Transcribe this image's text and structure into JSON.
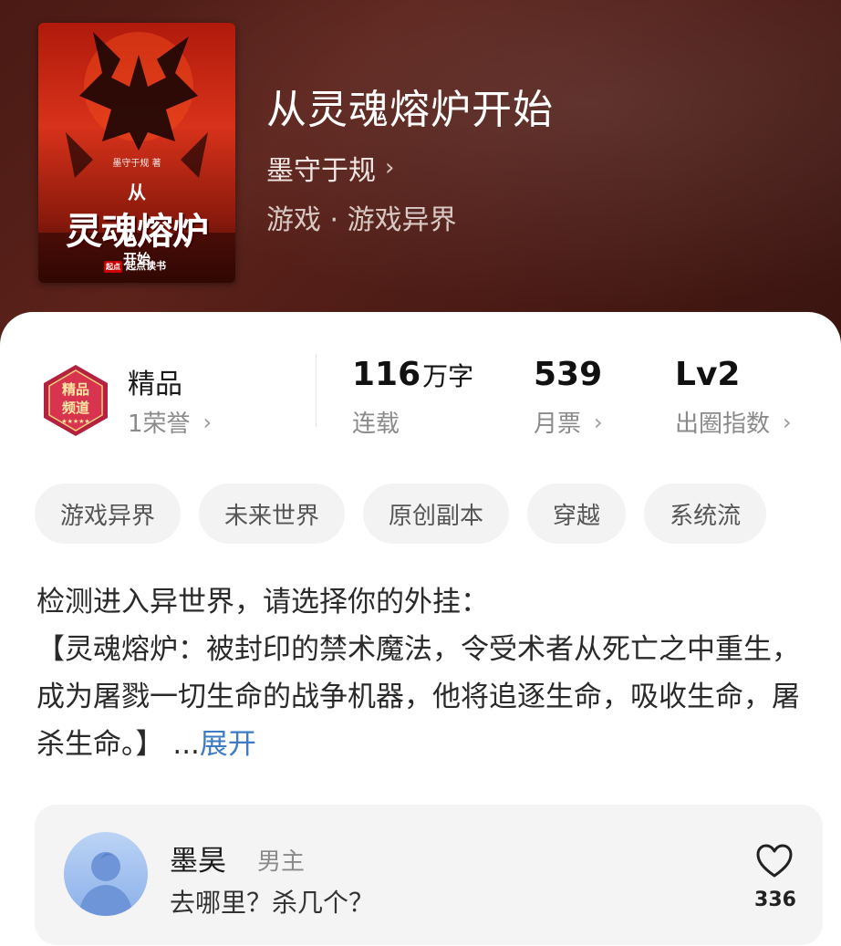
{
  "book": {
    "title": "从灵魂熔炉开始",
    "author": "墨守于规",
    "author_chevron": "›",
    "genre": "游戏 · 游戏异界",
    "cover": {
      "author_credit": "墨守于规 著",
      "title_line1": "从",
      "title_line2": "灵魂熔炉",
      "title_line3": "开始",
      "publisher_badge": "起点",
      "publisher": "起点读书"
    }
  },
  "stats": {
    "badge": {
      "icon": "premium-channel-badge-icon",
      "badge_text_1": "精品",
      "badge_text_2": "频道",
      "label": "精品",
      "sub": "1荣誉"
    },
    "words": {
      "value": "116",
      "unit": "万字",
      "sub": "连载"
    },
    "votes": {
      "value": "539",
      "sub": "月票"
    },
    "level": {
      "value": "Lv2",
      "sub": "出圈指数"
    },
    "chevron": "›"
  },
  "tags": [
    "游戏异界",
    "未来世界",
    "原创副本",
    "穿越",
    "系统流"
  ],
  "description": {
    "line1": "检测进入异世界，请选择你的外挂：",
    "line2": "【灵魂熔炉：被封印的禁术魔法，令受术者从死亡之中重生，成为屠戮一切生命的战争机器，他将追逐生命，吸收生命，屠杀生命。】",
    "ellipsis": " ...",
    "expand": "展开"
  },
  "character": {
    "name": "墨昊",
    "role": "男主",
    "quote": "去哪里？杀几个？",
    "likes": "336",
    "like_icon": "heart-outline-icon",
    "avatar_icon": "silhouette-avatar-icon"
  },
  "colors": {
    "hero_bg": "#4e1c16",
    "expand_link": "#3d7cc4",
    "tag_bg": "#f3f3f3"
  }
}
